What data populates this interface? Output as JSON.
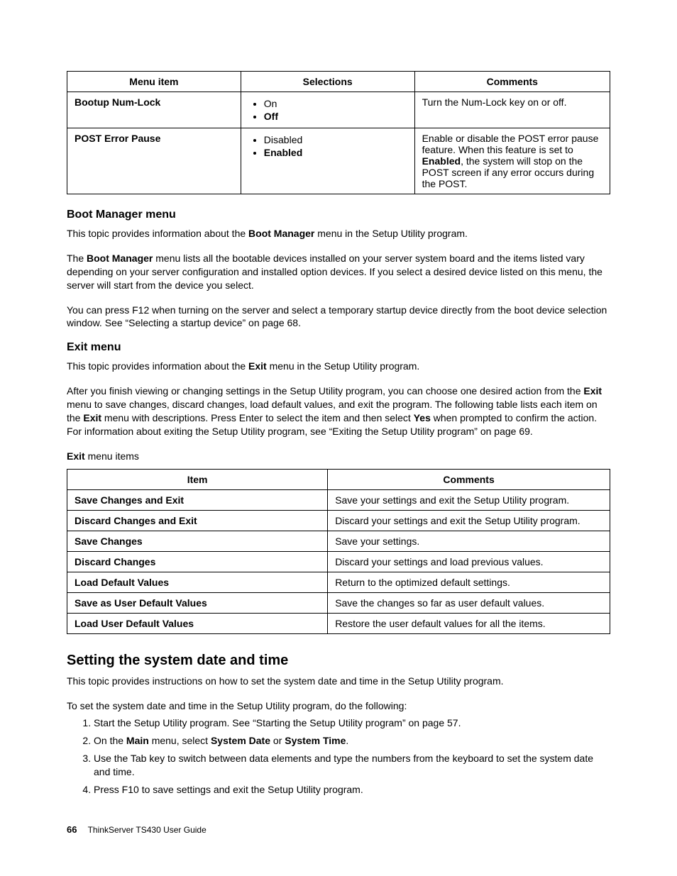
{
  "table1": {
    "headers": [
      "Menu item",
      "Selections",
      "Comments"
    ],
    "rows": [
      {
        "menu": "Bootup Num-Lock",
        "selections": [
          {
            "label": "On",
            "bold": false
          },
          {
            "label": "Off",
            "bold": true
          }
        ],
        "comment_parts": [
          {
            "text": "Turn the Num-Lock key on or off.",
            "bold": false
          }
        ]
      },
      {
        "menu": "POST Error Pause",
        "selections": [
          {
            "label": "Disabled",
            "bold": false
          },
          {
            "label": "Enabled",
            "bold": true
          }
        ],
        "comment_parts": [
          {
            "text": "Enable or disable the POST error pause feature.  When this feature is set to ",
            "bold": false
          },
          {
            "text": "Enabled",
            "bold": true
          },
          {
            "text": ", the system will stop on the POST screen if any error occurs during the POST.",
            "bold": false
          }
        ]
      }
    ]
  },
  "boot_manager": {
    "heading": "Boot Manager menu",
    "p1_parts": [
      {
        "text": "This topic provides information about the ",
        "bold": false
      },
      {
        "text": "Boot Manager",
        "bold": true
      },
      {
        "text": " menu in the Setup Utility program.",
        "bold": false
      }
    ],
    "p2_parts": [
      {
        "text": "The ",
        "bold": false
      },
      {
        "text": "Boot Manager",
        "bold": true
      },
      {
        "text": " menu lists all the bootable devices installed on your server system board and the items listed vary depending on your server configuration and installed option devices.  If you select a desired device listed on this menu, the server will start from the device you select.",
        "bold": false
      }
    ],
    "p3": "You can press F12 when turning on the server and select a temporary startup device directly from the boot device selection window.  See “Selecting a startup device” on page 68."
  },
  "exit_menu": {
    "heading": "Exit menu",
    "p1_parts": [
      {
        "text": "This topic provides information about the ",
        "bold": false
      },
      {
        "text": "Exit",
        "bold": true
      },
      {
        "text": " menu in the Setup Utility program.",
        "bold": false
      }
    ],
    "p2_parts": [
      {
        "text": "After you finish viewing or changing settings in the Setup Utility program, you can choose one desired action from the ",
        "bold": false
      },
      {
        "text": "Exit",
        "bold": true
      },
      {
        "text": " menu to save changes, discard changes, load default values, and exit the program.  The following table lists each item on the ",
        "bold": false
      },
      {
        "text": "Exit",
        "bold": true
      },
      {
        "text": " menu with descriptions.  Press Enter to select the item and then select ",
        "bold": false
      },
      {
        "text": "Yes",
        "bold": true
      },
      {
        "text": " when prompted to confirm the action.  For information about exiting the Setup Utility program, see “Exiting the Setup Utility program” on page 69.",
        "bold": false
      }
    ],
    "caption_parts": [
      {
        "text": "Exit",
        "bold": true
      },
      {
        "text": " menu items",
        "bold": false
      }
    ]
  },
  "table2": {
    "headers": [
      "Item",
      "Comments"
    ],
    "rows": [
      {
        "item": "Save Changes and Exit",
        "comment": "Save your settings and exit the Setup Utility program."
      },
      {
        "item": "Discard Changes and Exit",
        "comment": "Discard your settings and exit the Setup Utility program."
      },
      {
        "item": "Save Changes",
        "comment": "Save your settings."
      },
      {
        "item": "Discard Changes",
        "comment": "Discard your settings and load previous values."
      },
      {
        "item": "Load Default Values",
        "comment": "Return to the optimized default settings."
      },
      {
        "item": "Save as User Default Values",
        "comment": "Save the changes so far as user default values."
      },
      {
        "item": "Load User Default Values",
        "comment": "Restore the user default values for all the items."
      }
    ]
  },
  "datetime": {
    "heading": "Setting the system date and time",
    "p1": "This topic provides instructions on how to set the system date and time in the Setup Utility program.",
    "p2": "To set the system date and time in the Setup Utility program, do the following:",
    "steps": [
      [
        {
          "text": "Start the Setup Utility program.  See “Starting the Setup Utility program” on page 57.",
          "bold": false
        }
      ],
      [
        {
          "text": "On the ",
          "bold": false
        },
        {
          "text": "Main",
          "bold": true
        },
        {
          "text": " menu, select ",
          "bold": false
        },
        {
          "text": "System Date",
          "bold": true
        },
        {
          "text": " or ",
          "bold": false
        },
        {
          "text": "System Time",
          "bold": true
        },
        {
          "text": ".",
          "bold": false
        }
      ],
      [
        {
          "text": "Use the Tab key to switch between data elements and type the numbers from the keyboard to set the system date and time.",
          "bold": false
        }
      ],
      [
        {
          "text": "Press F10 to save settings and exit the Setup Utility program.",
          "bold": false
        }
      ]
    ]
  },
  "footer": {
    "page": "66",
    "title": "ThinkServer TS430 User Guide"
  }
}
